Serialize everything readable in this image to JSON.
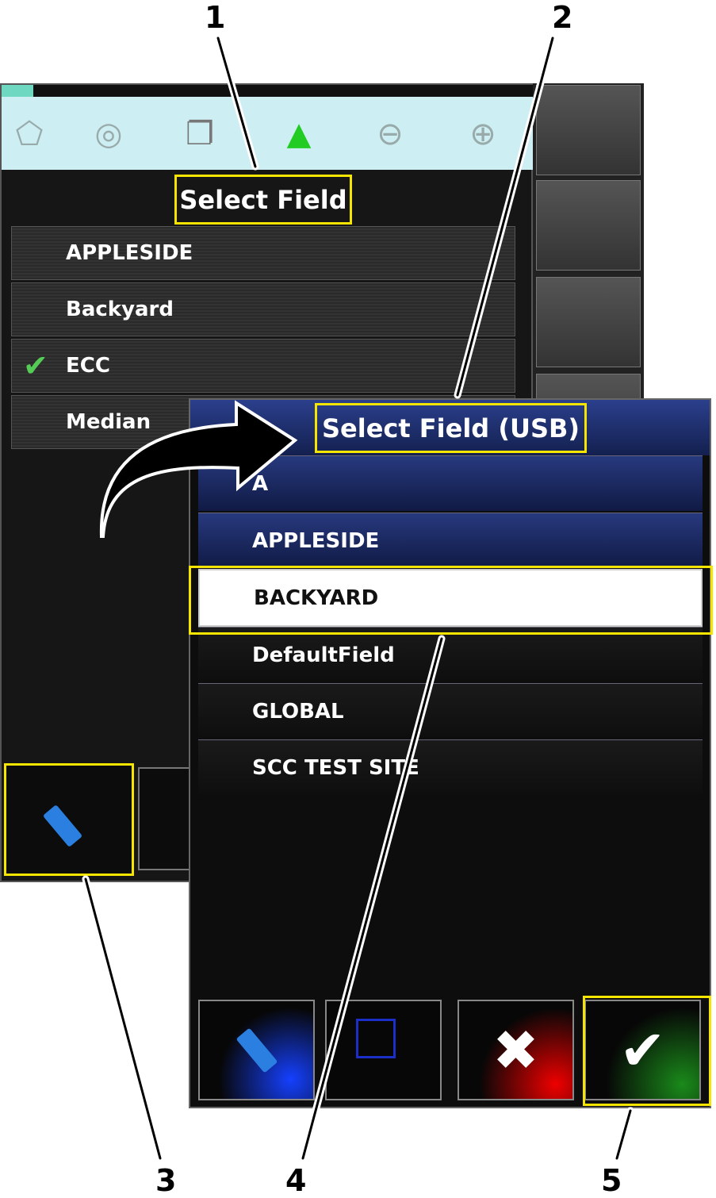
{
  "back_panel": {
    "title": "Select Field",
    "toolbar_icons": [
      "field-boundary-icon",
      "target-icon",
      "layers-icon",
      "field-map-icon",
      "zoom-out-icon",
      "zoom-in-icon"
    ],
    "fields": [
      {
        "name": "APPLESIDE",
        "selected": false
      },
      {
        "name": "Backyard",
        "selected": false
      },
      {
        "name": "ECC",
        "selected": true
      },
      {
        "name": "Median",
        "selected": false
      }
    ],
    "check_glyph": "✔"
  },
  "front_panel": {
    "title": "Select Field (USB)",
    "fields": [
      "A",
      "APPLESIDE",
      "BACKYARD",
      "DefaultField",
      "GLOBAL",
      "SCC TEST SITE"
    ],
    "selected": "BACKYARD",
    "buttons": {
      "cancel": "✖",
      "confirm": "✔"
    }
  },
  "callouts": [
    "1",
    "2",
    "3",
    "4",
    "5"
  ],
  "colors": {
    "highlight": "#f5e500",
    "header": "#1e2f6e",
    "toolbar": "#cdeef2"
  }
}
